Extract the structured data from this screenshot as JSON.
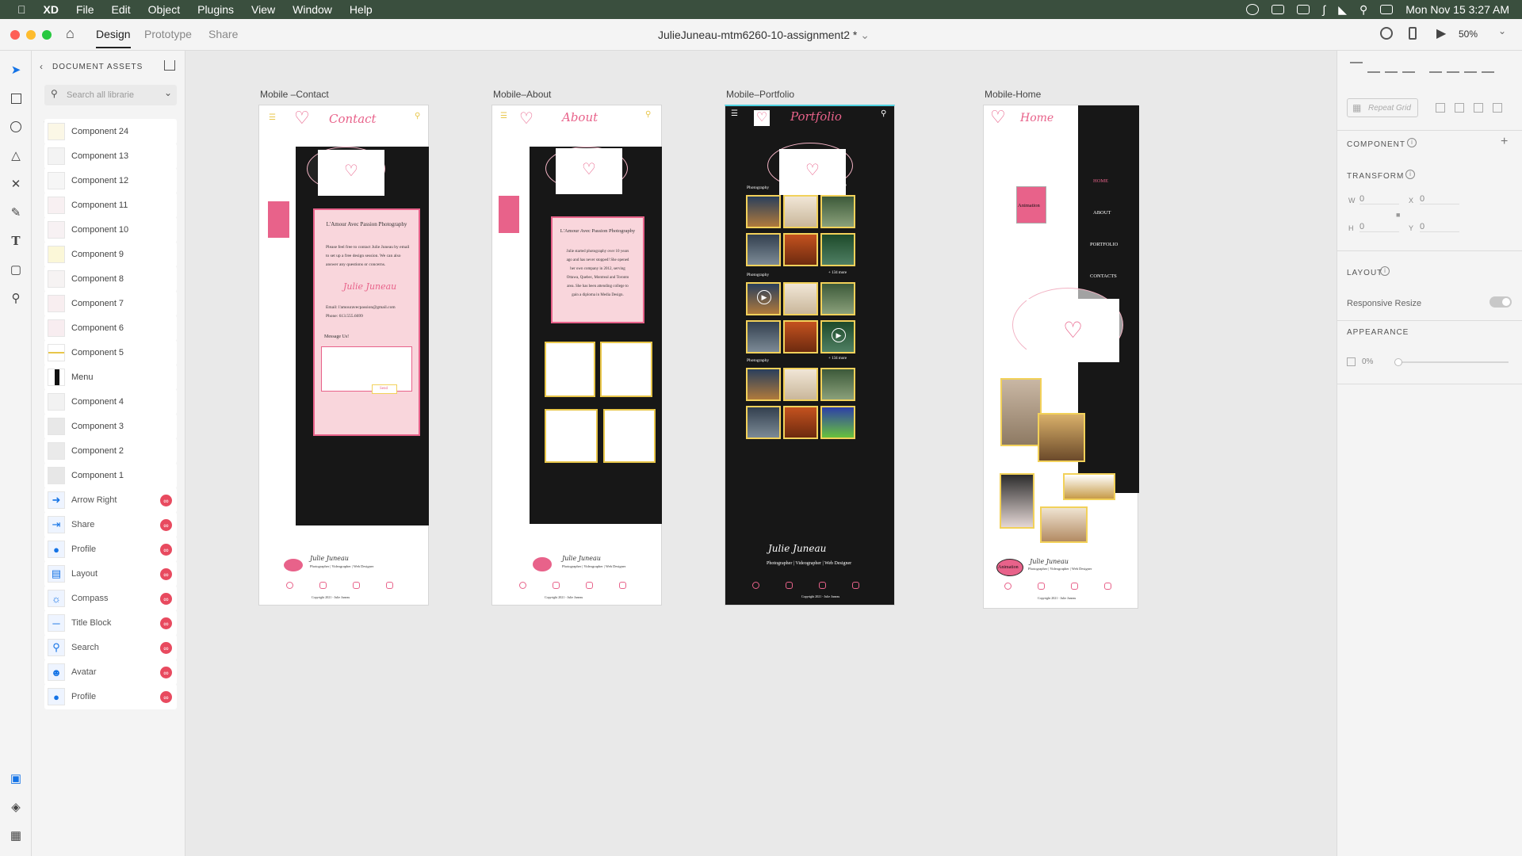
{
  "menubar": {
    "app": "XD",
    "items": [
      "File",
      "Edit",
      "Object",
      "Plugins",
      "View",
      "Window",
      "Help"
    ],
    "clock": "Mon Nov 15  3:27 AM"
  },
  "titlebar": {
    "tabs": [
      "Design",
      "Prototype",
      "Share"
    ],
    "active_tab": "Design",
    "doc_title": "JulieJuneau-mtm6260-10-assignment2 *",
    "zoom": "50%"
  },
  "assets": {
    "header": "DOCUMENT ASSETS",
    "search_placeholder": "Search all librarie",
    "items": [
      {
        "label": "Component 24",
        "linked": false
      },
      {
        "label": "Component 13",
        "linked": false
      },
      {
        "label": "Component 12",
        "linked": false
      },
      {
        "label": "Component 11",
        "linked": false
      },
      {
        "label": "Component 10",
        "linked": false
      },
      {
        "label": "Component 9",
        "linked": false
      },
      {
        "label": "Component 8",
        "linked": false
      },
      {
        "label": "Component 7",
        "linked": false
      },
      {
        "label": "Component 6",
        "linked": false
      },
      {
        "label": "Component 5",
        "linked": false
      },
      {
        "label": "Menu",
        "linked": false
      },
      {
        "label": "Component 4",
        "linked": false
      },
      {
        "label": "Component 3",
        "linked": false
      },
      {
        "label": "Component 2",
        "linked": false
      },
      {
        "label": "Component 1",
        "linked": false
      },
      {
        "label": "Arrow Right",
        "linked": true
      },
      {
        "label": "Share",
        "linked": true
      },
      {
        "label": "Profile",
        "linked": true
      },
      {
        "label": "Layout",
        "linked": true
      },
      {
        "label": "Compass",
        "linked": true
      },
      {
        "label": "Title Block",
        "linked": true
      },
      {
        "label": "Search",
        "linked": true
      },
      {
        "label": "Avatar",
        "linked": true
      },
      {
        "label": "Profile",
        "linked": true
      }
    ]
  },
  "artboards": {
    "contact": {
      "title": "Mobile –Contact",
      "heading": "Contact",
      "card_title": "L'Amour Avec Passion Photography",
      "body": "Please feel free to contact Julie Juneau by email to set up a free design session. We can also answer any questions or concerns.",
      "signature": "Julie Juneau",
      "email": "Email: l'amouravecpassion@gmail.com",
      "phone": "Phone: 613.555.6699",
      "message": "Message Us!",
      "send": "Send",
      "footer_name": "Julie Juneau",
      "footer_role": "Photographer | Videographer | Web Designer",
      "copyright": "Copyright 2021 - Julie Juneau"
    },
    "about": {
      "title": "Mobile–About",
      "heading": "About",
      "card_title": "L'Amour Avec Passion Photography",
      "body": "Julie started photography over 10 years ago and has never stopped! She opened her own company in 2012, serving Ottawa, Quebec, Montreal and Toronto area. She has been attending college to gain a diploma in Media Design.",
      "footer_name": "Julie Juneau",
      "footer_role": "Photographer | Videographer | Web Designer",
      "copyright": "Copyright 2021 - Julie Juneau"
    },
    "portfolio": {
      "title": "Mobile–Portfolio",
      "heading": "Portfolio",
      "section_label": "Photography",
      "more": "+ 134 more",
      "footer_name": "Julie Juneau",
      "footer_role": "Photographer | Videographer | Web Designer",
      "copyright": "Copyright 2021 - Julie Juneau"
    },
    "home": {
      "title": "Mobile-Home",
      "heading": "Home",
      "animation": "Animation",
      "nav": [
        "HOME",
        "ABOUT",
        "PORTFOLIO",
        "CONTACTS"
      ],
      "footer_name": "Julie Juneau",
      "footer_role": "Photographer | Videographer | Web Designer",
      "copyright": "Copyright 2021 - Julie Juneau"
    }
  },
  "props": {
    "repeat_grid": "Repeat Grid",
    "component": "COMPONENT",
    "transform": "TRANSFORM",
    "w_label": "W",
    "w": "0",
    "x_label": "X",
    "x": "0",
    "h_label": "H",
    "h": "0",
    "y_label": "Y",
    "y": "0",
    "layout": "LAYOUT",
    "responsive": "Responsive Resize",
    "appearance": "APPEARANCE",
    "opacity": "0%"
  },
  "colors": {
    "accent_pink": "#e8628a",
    "menubar": "#3a4f3e",
    "photo_border": "#f2d15a"
  }
}
